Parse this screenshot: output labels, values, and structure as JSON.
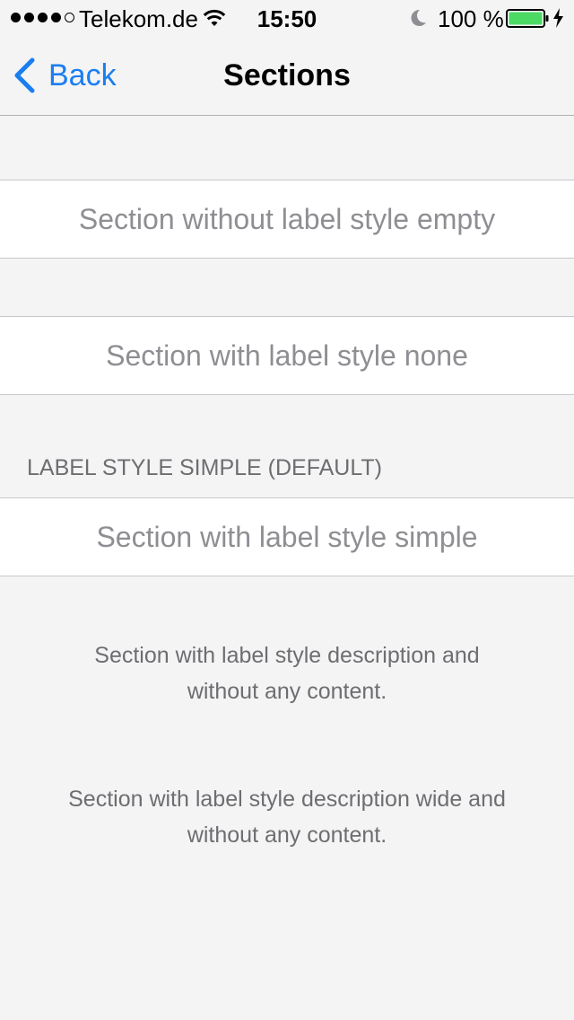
{
  "status_bar": {
    "carrier": "Telekom.de",
    "time": "15:50",
    "battery_percent": "100 %",
    "signal_bars_filled": 4,
    "signal_bars_total": 5,
    "battery_level": 1.0,
    "icons": [
      "signal-dots-icon",
      "wifi-icon",
      "moon-icon",
      "battery-icon",
      "charging-bolt-icon"
    ]
  },
  "nav": {
    "back_label": "Back",
    "title": "Sections"
  },
  "sections": [
    {
      "label": "",
      "cell_text": "Section without label style empty"
    },
    {
      "label": "",
      "cell_text": "Section with label style none"
    },
    {
      "label": "LABEL STYLE SIMPLE (DEFAULT)",
      "cell_text": "Section with label style simple"
    }
  ],
  "descriptions": [
    {
      "line1": "Section with label style description and",
      "line2": "without any content."
    },
    {
      "line1": "Section with label style description wide and",
      "line2": "without any content."
    }
  ],
  "colors": {
    "accent": "#1a7ef1",
    "background": "#f4f4f4",
    "cell_text": "#8e8e93",
    "header_text": "#6d6d72",
    "battery_fill": "#4cd964"
  }
}
